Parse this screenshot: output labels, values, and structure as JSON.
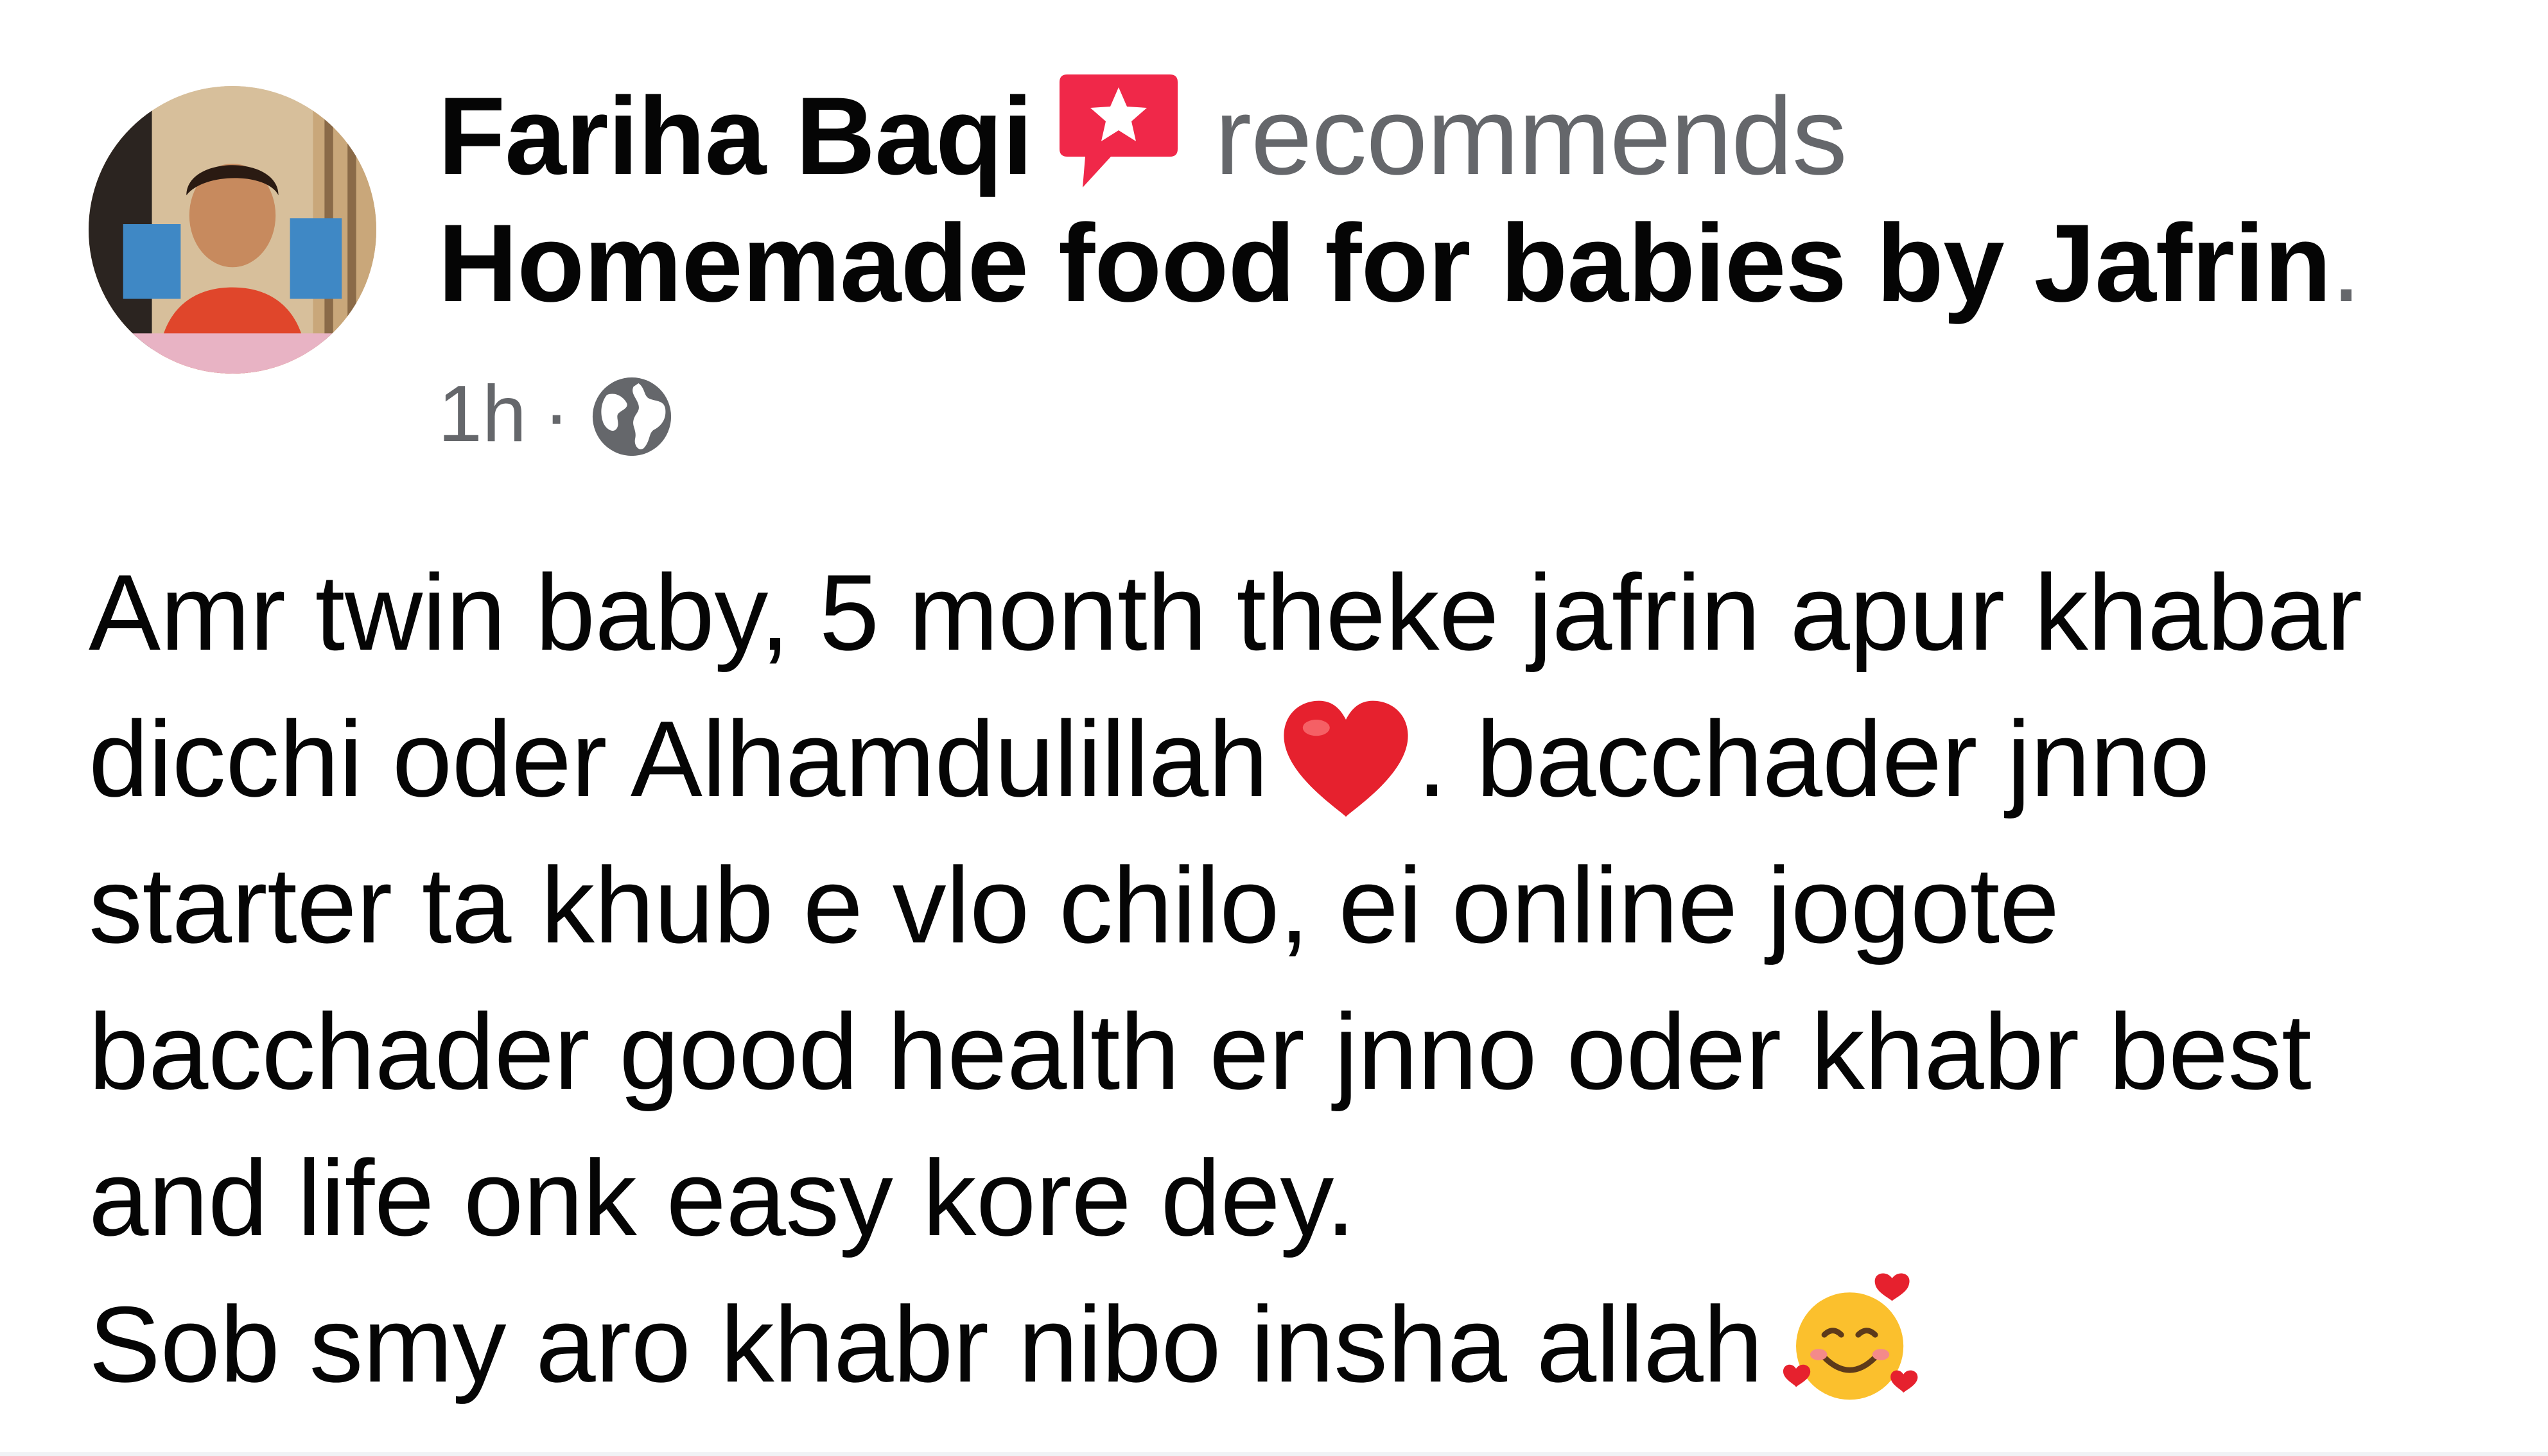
{
  "header": {
    "author_name": "Fariha Baqi",
    "action_verb": "recommends",
    "page_name": "Homemade food for babies by Jafrin",
    "period": ".",
    "timestamp": "1h",
    "separator": "·",
    "audience_icon": "globe-icon",
    "recommend_icon": "recommend-star-badge-icon",
    "avatar": "profile-photo"
  },
  "post": {
    "lines": [
      {
        "text": "Amr twin baby, 5 month theke jafrin apur khabar"
      },
      {
        "before": "dicchi oder Alhamdulillah",
        "emoji": "red-heart-emoji",
        "after": ". bacchader jnno"
      },
      {
        "text": "starter ta khub e vlo chilo, ei online jogote"
      },
      {
        "text": "bacchader good health er jnno oder khabr best"
      },
      {
        "text": "and life onk easy kore dey."
      },
      {
        "before": "Sob smy aro khabr nibo insha allah",
        "emoji": "smiling-face-with-hearts-emoji"
      }
    ]
  },
  "colors": {
    "primary_text": "#050505",
    "secondary_text": "#65676b",
    "badge_red": "#f02849",
    "background": "#ffffff"
  }
}
